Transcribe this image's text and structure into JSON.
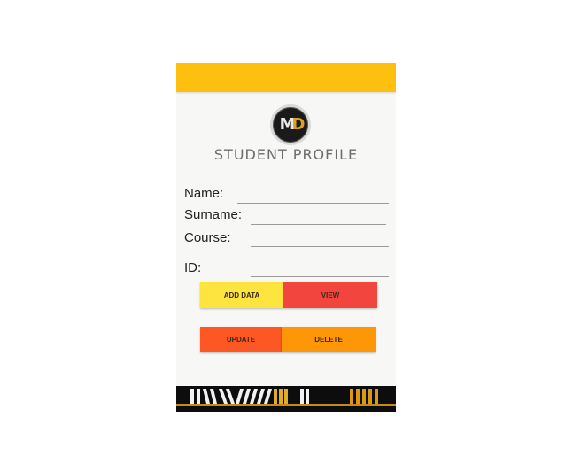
{
  "app": {
    "logo_letters": [
      "M",
      "D"
    ],
    "title": "STUDENT PROFILE"
  },
  "form": {
    "fields": [
      {
        "label": "Name:",
        "value": ""
      },
      {
        "label": "Surname:",
        "value": ""
      },
      {
        "label": "Course:",
        "value": ""
      },
      {
        "label": "ID:",
        "value": ""
      }
    ]
  },
  "buttons": {
    "add_data": "ADD DATA",
    "view": "VIEW",
    "update": "UPDATE",
    "delete": "DELETE"
  },
  "colors": {
    "appbar": "#fdc00f",
    "add_data": "#fde43f",
    "view": "#f1453d",
    "update": "#fd5724",
    "delete": "#fd9707",
    "footer": "#0d0d0d",
    "footer_accent": "#c98a10"
  },
  "icons": {
    "logo": "md-logo-icon",
    "footer": "stripe-pattern-banner"
  }
}
